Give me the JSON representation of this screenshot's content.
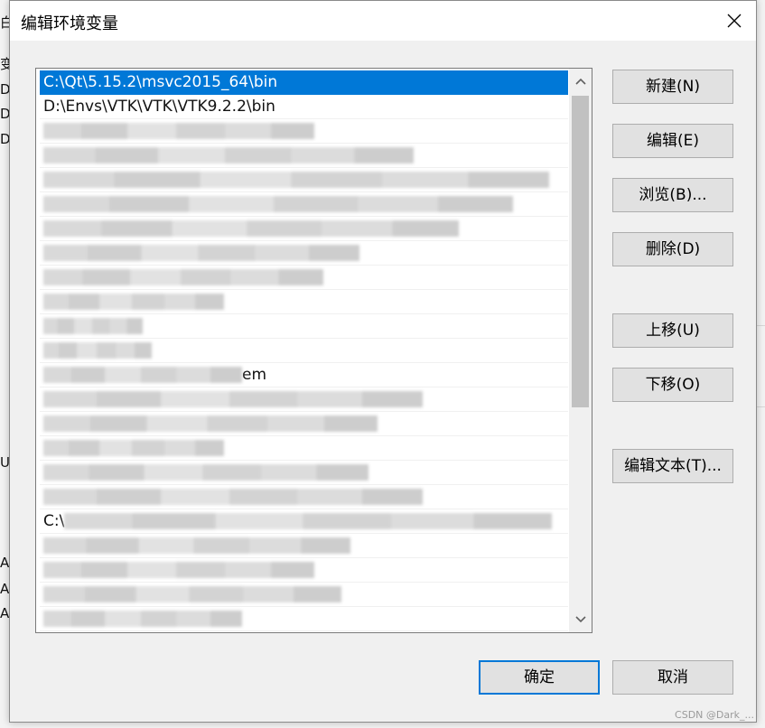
{
  "dialog": {
    "title": "编辑环境变量",
    "close_icon": "close-icon"
  },
  "path_list": {
    "rows": [
      {
        "text": "C:\\Qt\\5.15.2\\msvc2015_64\\bin",
        "selected": true
      },
      {
        "text": "D:\\Envs\\VTK\\VTK\\VTK9.2.2\\bin",
        "selected": false
      },
      {
        "text": "",
        "selected": false
      },
      {
        "text": "",
        "selected": false
      },
      {
        "text": "",
        "selected": false
      },
      {
        "text": "",
        "selected": false
      },
      {
        "text": "",
        "selected": false
      },
      {
        "text": "",
        "selected": false
      },
      {
        "text": "",
        "selected": false
      },
      {
        "text": "",
        "selected": false
      },
      {
        "text": "",
        "selected": false
      },
      {
        "text": "",
        "selected": false
      },
      {
        "text": "em",
        "selected": false
      },
      {
        "text": "",
        "selected": false
      },
      {
        "text": "",
        "selected": false
      },
      {
        "text": "",
        "selected": false
      },
      {
        "text": "",
        "selected": false
      },
      {
        "text": "",
        "selected": false
      },
      {
        "text": "C:\\",
        "selected": false
      },
      {
        "text": "",
        "selected": false
      },
      {
        "text": "",
        "selected": false
      },
      {
        "text": "",
        "selected": false
      },
      {
        "text": "",
        "selected": false
      }
    ]
  },
  "buttons": {
    "new": "新建(N)",
    "edit": "编辑(E)",
    "browse": "浏览(B)...",
    "delete": "删除(D)",
    "move_up": "上移(U)",
    "move_down": "下移(O)",
    "edit_text": "编辑文本(T)...",
    "ok": "确定",
    "cancel": "取消"
  },
  "watermark": "CSDN @Dark_...",
  "colors": {
    "selection": "#0078d7",
    "button_face": "#e1e1e1",
    "dialog_bg": "#f0f0f0"
  }
}
